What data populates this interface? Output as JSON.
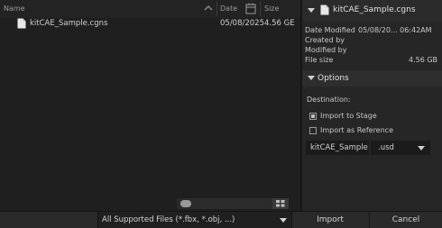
{
  "columns": {
    "name": "Name",
    "date": "Date",
    "size": "Size"
  },
  "files": [
    {
      "name": "kitCAE_Sample.cgns",
      "date": "05/08/2025",
      "size": "4.56 GE"
    }
  ],
  "info": {
    "filename": "kitCAE_Sample.cgns",
    "date_modified_label": "Date Modified",
    "date_modified_value": "05/08/20... 06:42AM",
    "created_by_label": "Created by",
    "modified_by_label": "Modified by",
    "file_size_label": "File size",
    "file_size_value": "4.56 GB"
  },
  "options": {
    "header": "Options",
    "destination_label": "Destination:",
    "import_to_stage": "Import to Stage",
    "import_to_stage_checked": true,
    "import_as_reference": "Import as Reference",
    "import_as_reference_checked": false,
    "filename_field": "kitCAE_Sample",
    "extension": ".usd"
  },
  "bottom": {
    "filter": "All Supported Files (*.fbx, *.obj, ...)",
    "import": "Import",
    "cancel": "Cancel"
  }
}
